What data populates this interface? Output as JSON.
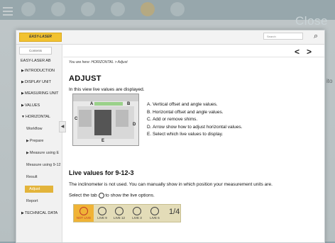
{
  "background": {
    "close_label": "Close",
    "right_edge_text": "ito"
  },
  "window": {
    "logo": "EASY-LASER",
    "search_placeholder": "Search",
    "nav_prev": "<",
    "nav_next": ">"
  },
  "sidebar": {
    "tab": "Contents",
    "items": [
      {
        "label": "EASY-LASER AB"
      },
      {
        "label": "INTRODUCTION"
      },
      {
        "label": "DISPLAY UNIT"
      },
      {
        "label": "MEASURING UNIT"
      },
      {
        "label": "VALUES"
      },
      {
        "label": "HORIZONTAL"
      },
      {
        "label": "Workflow"
      },
      {
        "label": "Prepare"
      },
      {
        "label": "Measure using E"
      },
      {
        "label": "Measure using 9-12"
      },
      {
        "label": "Result"
      },
      {
        "label": "Adjust"
      },
      {
        "label": "Report"
      },
      {
        "label": "TECHNICAL DATA"
      }
    ]
  },
  "content": {
    "breadcrumb": "You are here: HORIZONTAL > Adjust",
    "title": "ADJUST",
    "intro": "In this view live values are displayed.",
    "image_labels": {
      "a": "A",
      "b": "B",
      "c": "C",
      "d": "D",
      "e": "E"
    },
    "list": [
      "A.  Vertical offset and angle values.",
      "B.  Horizontal offset and angle values.",
      "C.  Add or remove shims.",
      "D.  Arrow show how to adjust horizontal values.",
      "E.  Select which live values to display."
    ],
    "subtitle": "Live values for 9-12-3",
    "para1": "The inclinometer is not used. You can manually show in which position your measurement units are.",
    "para2_before": "Select the tab",
    "para2_after": "to show the live options.",
    "tabs": [
      "NOT LIVE",
      "LIVE 9",
      "LIVE 12",
      "LIVE 3",
      "LIVE 6"
    ],
    "page_indicator": "1/4"
  },
  "colors": {
    "accent": "#e3b43b",
    "selected_tab": "#f0b336"
  }
}
